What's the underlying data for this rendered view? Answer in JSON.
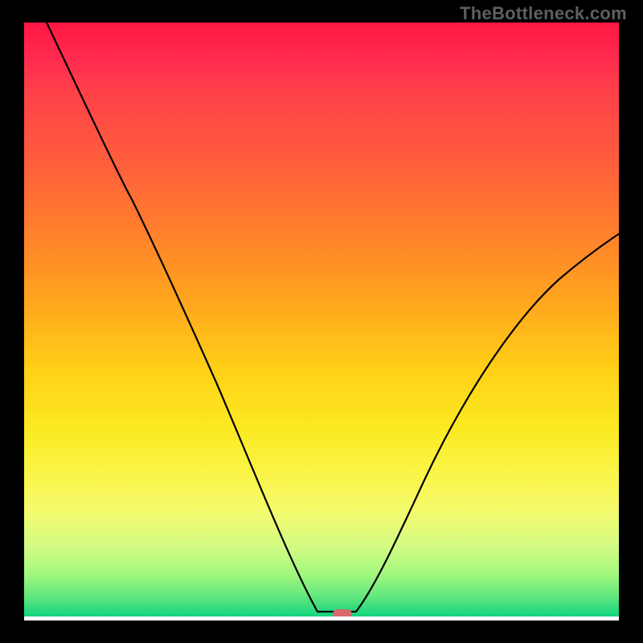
{
  "watermark": "TheBottleneck.com",
  "chart_data": {
    "type": "line",
    "title": "",
    "xlabel": "",
    "ylabel": "",
    "xlim": [
      0,
      100
    ],
    "ylim": [
      0,
      100
    ],
    "grid": false,
    "legend": false,
    "background_gradient": {
      "direction": "top-to-bottom",
      "stops": [
        {
          "color": "#ff1744",
          "pos": 0
        },
        {
          "color": "#ff7d2e",
          "pos": 34
        },
        {
          "color": "#ffd016",
          "pos": 58
        },
        {
          "color": "#faf54a",
          "pos": 76
        },
        {
          "color": "#62e77e",
          "pos": 96
        },
        {
          "color": "#0ec97b",
          "pos": 100
        }
      ]
    },
    "series": [
      {
        "name": "bottleneck-curve",
        "x": [
          4,
          8,
          12,
          16,
          20,
          24,
          28,
          32,
          36,
          40,
          44,
          48,
          50,
          52,
          53,
          56,
          60,
          64,
          68,
          72,
          76,
          80,
          84,
          88,
          92,
          96,
          100
        ],
        "values": [
          100,
          91,
          82,
          73,
          63,
          55,
          48,
          41,
          33,
          26,
          19,
          11,
          4,
          0.5,
          0.5,
          0.5,
          3,
          8,
          14,
          20,
          27,
          33,
          39,
          45,
          51,
          56,
          61
        ]
      }
    ],
    "marker": {
      "x": 53.5,
      "y": 0.2,
      "shape": "rounded-rect",
      "color": "#d86a6e"
    },
    "flat_bottom_segment": {
      "x_start": 50,
      "x_end": 56,
      "y": 0.5
    }
  }
}
